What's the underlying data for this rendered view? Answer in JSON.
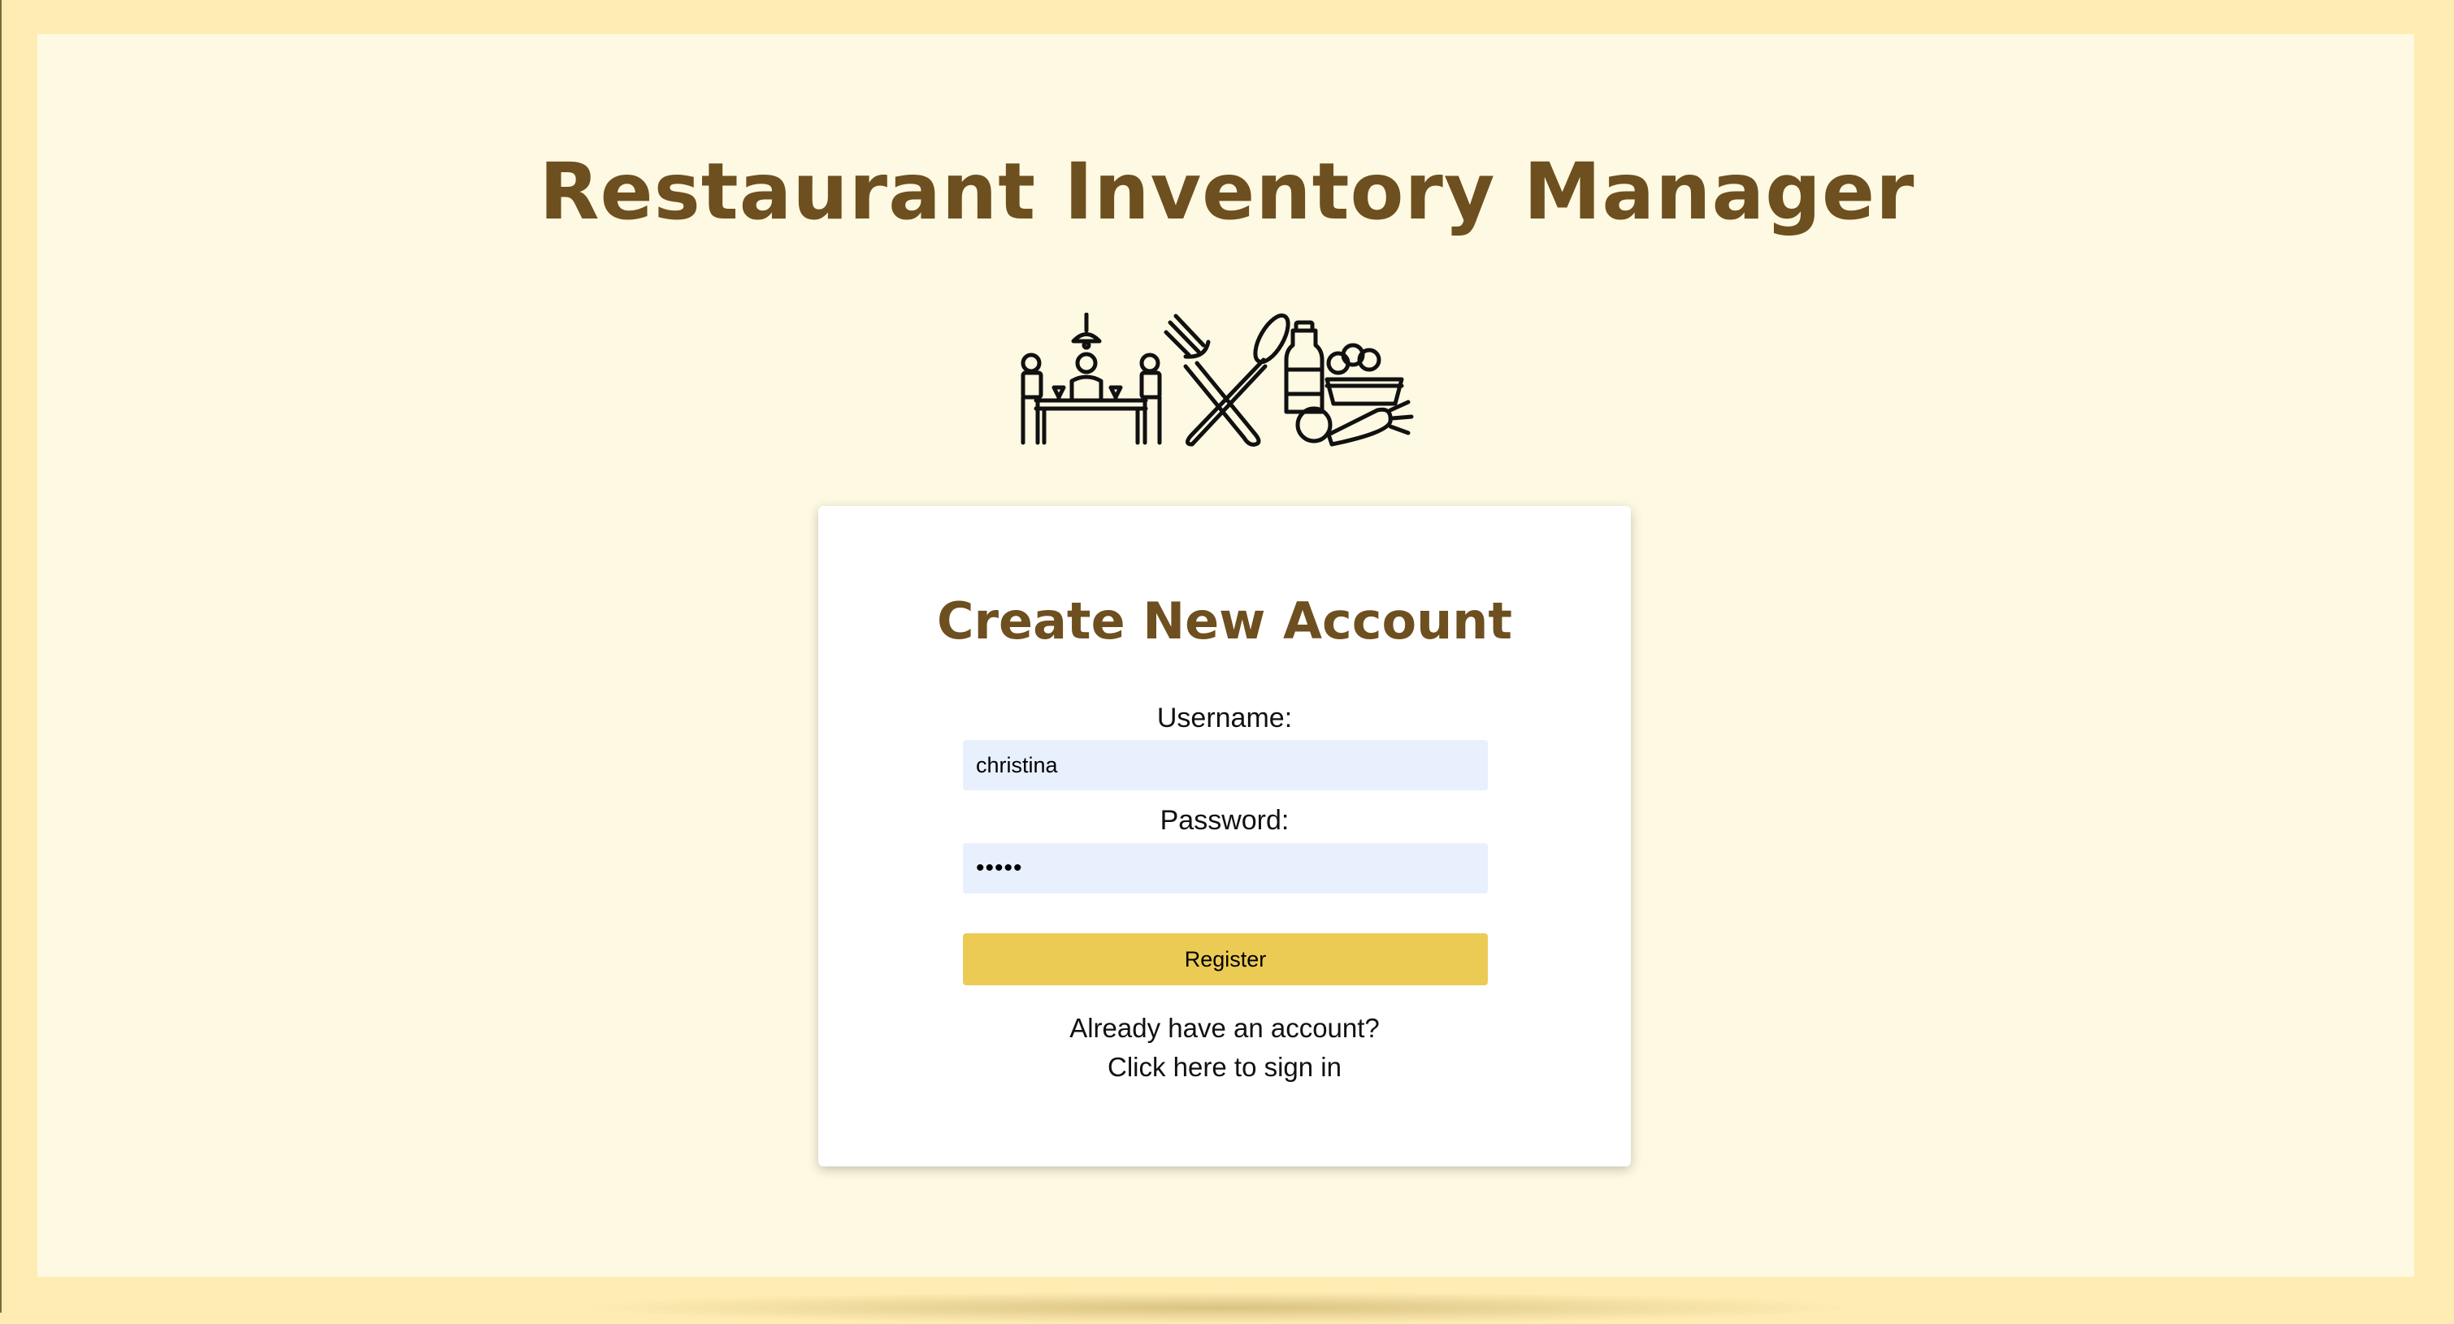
{
  "app": {
    "title": "Restaurant Inventory Manager"
  },
  "hero": {
    "icons": [
      "dining-table-icon",
      "fork-spoon-icon",
      "groceries-icon"
    ]
  },
  "register_form": {
    "title": "Create New Account",
    "username_label": "Username:",
    "username_value": "christina",
    "password_label": "Password:",
    "password_value": "•••••",
    "register_label": "Register",
    "signin_prompt": "Already have an account?",
    "signin_link": "Click here to sign in"
  },
  "colors": {
    "page_bg": "#feecb3",
    "panel_bg": "#fdf9e2",
    "title_color": "#6e4f1f",
    "button_bg": "#eccb55",
    "input_bg": "#e8f0fe"
  }
}
